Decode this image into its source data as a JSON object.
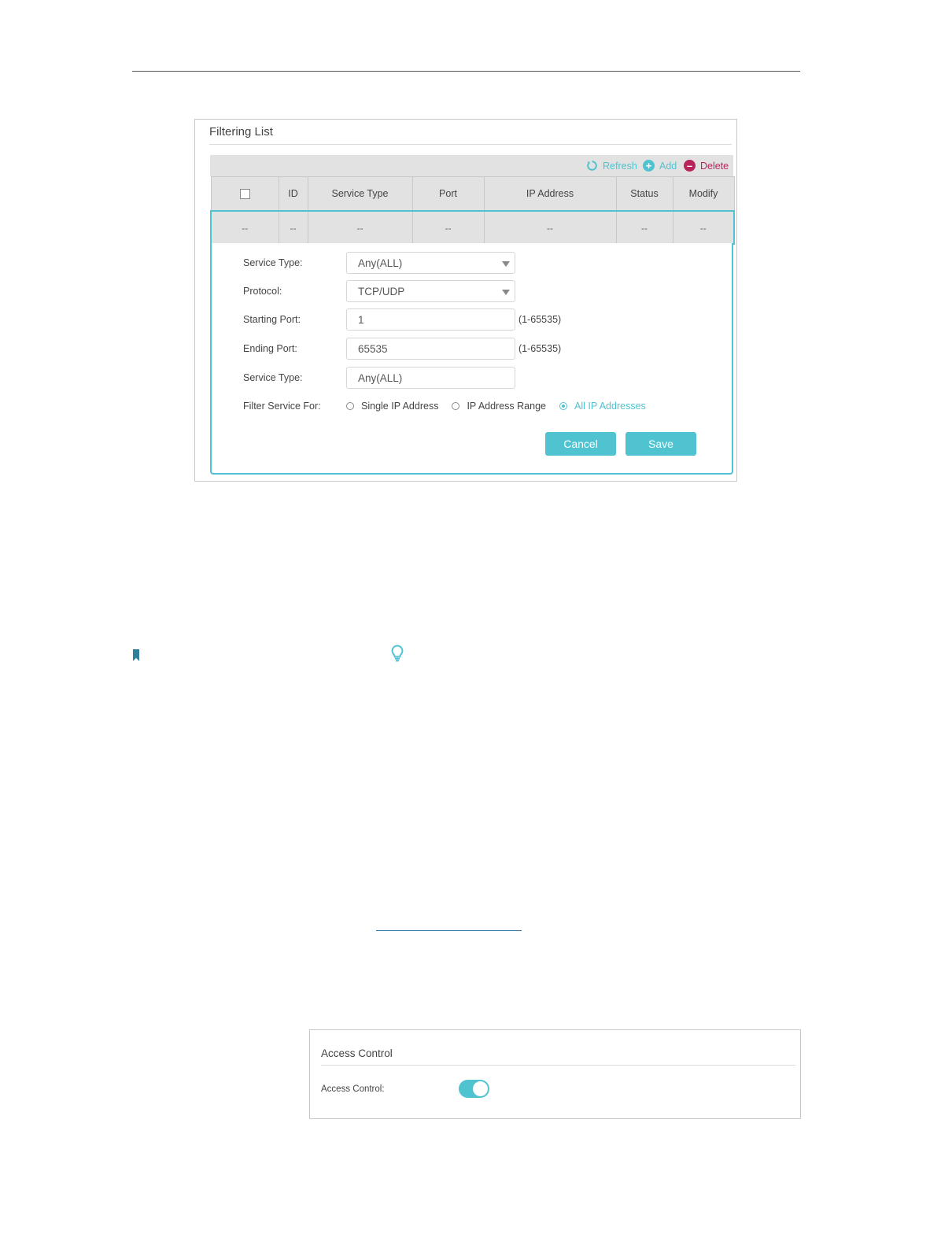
{
  "filtering": {
    "title": "Filtering List",
    "toolbar": {
      "refresh": "Refresh",
      "add": "Add",
      "delete": "Delete"
    },
    "columns": [
      "ID",
      "Service Type",
      "Port",
      "IP Address",
      "Status",
      "Modify"
    ],
    "empty_row": [
      "--",
      "--",
      "--",
      "--",
      "--",
      "--",
      "--"
    ],
    "form": {
      "service_type_label": "Service Type:",
      "service_type_value": "Any(ALL)",
      "protocol_label": "Protocol:",
      "protocol_value": "TCP/UDP",
      "starting_port_label": "Starting Port:",
      "starting_port_value": "1",
      "starting_port_hint": "(1-65535)",
      "ending_port_label": "Ending Port:",
      "ending_port_value": "65535",
      "ending_port_hint": "(1-65535)",
      "service_type2_label": "Service Type:",
      "service_type2_value": "Any(ALL)",
      "filter_for_label": "Filter Service For:",
      "filter_options": [
        "Single IP Address",
        "IP Address Range",
        "All IP Addresses"
      ],
      "filter_selected": "All IP Addresses"
    },
    "buttons": {
      "cancel": "Cancel",
      "save": "Save"
    }
  },
  "access_control": {
    "title": "Access Control",
    "label": "Access Control:",
    "enabled": true
  },
  "colors": {
    "accent": "#4fc3cf",
    "delete": "#b7245c",
    "header_bg": "#e2e2e2"
  },
  "icons": [
    "refresh-icon",
    "add-icon",
    "delete-icon",
    "bookmark-icon",
    "lightbulb-icon",
    "dropdown-caret-icon"
  ]
}
